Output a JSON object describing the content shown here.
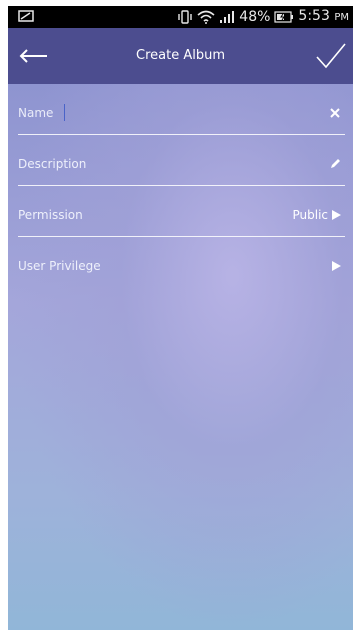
{
  "status_bar": {
    "battery_percent": "48%",
    "time": "5:53",
    "time_suffix": "PM"
  },
  "app_bar": {
    "title": "Create Album"
  },
  "form": {
    "name": {
      "placeholder": "Name",
      "value": ""
    },
    "description": {
      "label": "Description"
    },
    "permission": {
      "label": "Permission",
      "value": "Public"
    },
    "user_privilege": {
      "label": "User Privilege"
    }
  },
  "colors": {
    "app_bar": "#4c4d8f",
    "background_top": "#8e94d0",
    "background_bottom": "#91b6d8"
  },
  "icons": {
    "back": "arrow-left-icon",
    "done": "check-icon",
    "clear": "close-icon",
    "edit": "pencil-icon",
    "expand": "play-triangle-icon"
  }
}
